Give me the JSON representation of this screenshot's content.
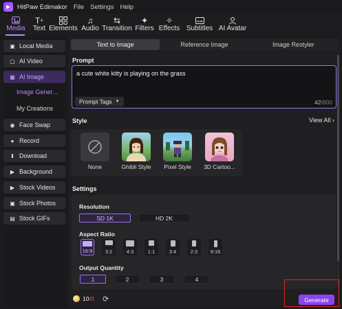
{
  "app": {
    "title": "HitPaw Edimakor",
    "menu": [
      "File",
      "Settings",
      "Help"
    ]
  },
  "toolbar": [
    {
      "label": "Media",
      "icon": "media-icon"
    },
    {
      "label": "Text",
      "icon": "text-icon"
    },
    {
      "label": "Elements",
      "icon": "elements-icon"
    },
    {
      "label": "Audio",
      "icon": "audio-icon"
    },
    {
      "label": "Transition",
      "icon": "transition-icon"
    },
    {
      "label": "Filters",
      "icon": "filters-icon"
    },
    {
      "label": "Effects",
      "icon": "effects-icon"
    },
    {
      "label": "Subtitles",
      "icon": "subtitles-icon"
    },
    {
      "label": "AI Avatar",
      "icon": "ai-avatar-icon"
    }
  ],
  "sidebar": {
    "items": [
      {
        "label": "Local Media",
        "icon": "folder-icon"
      },
      {
        "label": "AI Video",
        "icon": "ai-video-icon"
      },
      {
        "label": "AI Image",
        "icon": "ai-image-icon"
      },
      {
        "label": "Face Swap",
        "icon": "face-swap-icon"
      },
      {
        "label": "Record",
        "icon": "record-icon"
      },
      {
        "label": "Download",
        "icon": "download-icon"
      },
      {
        "label": "Background",
        "icon": "background-icon"
      },
      {
        "label": "Stock Videos",
        "icon": "stock-videos-icon"
      },
      {
        "label": "Stock Photos",
        "icon": "stock-photos-icon"
      },
      {
        "label": "Stock GIFs",
        "icon": "stock-gifs-icon"
      }
    ],
    "sub_items": [
      "Image Gener...",
      "My Creations"
    ]
  },
  "tabs": [
    "Text to Image",
    "Reference Image",
    "Image Restyler"
  ],
  "prompt": {
    "label": "Prompt",
    "value": "a cute white kitty is playing on the grass",
    "tags_label": "Prompt Tags",
    "count": "42",
    "max": "/800"
  },
  "style": {
    "label": "Style",
    "view_all": "View All",
    "options": [
      "None",
      "Ghibli Style",
      "Pixel Style",
      "3D Cartoo..."
    ]
  },
  "settings": {
    "label": "Settings",
    "resolution_label": "Resolution",
    "resolutions": [
      "SD 1K",
      "HD 2K"
    ],
    "aspect_label": "Aspect Ratio",
    "aspects": [
      "16:9",
      "3:2",
      "4:3",
      "1:1",
      "3:4",
      "2:3",
      "9:16"
    ],
    "quantity_label": "Output Quantity",
    "quantities": [
      "1",
      "2",
      "3",
      "4"
    ]
  },
  "footer": {
    "credits_used": "10",
    "credits_limit": "/0",
    "generate": "Generate"
  },
  "colors": {
    "accent": "#9d6ff0",
    "generate": "#8c44ee",
    "highlight": "#e0281f"
  }
}
